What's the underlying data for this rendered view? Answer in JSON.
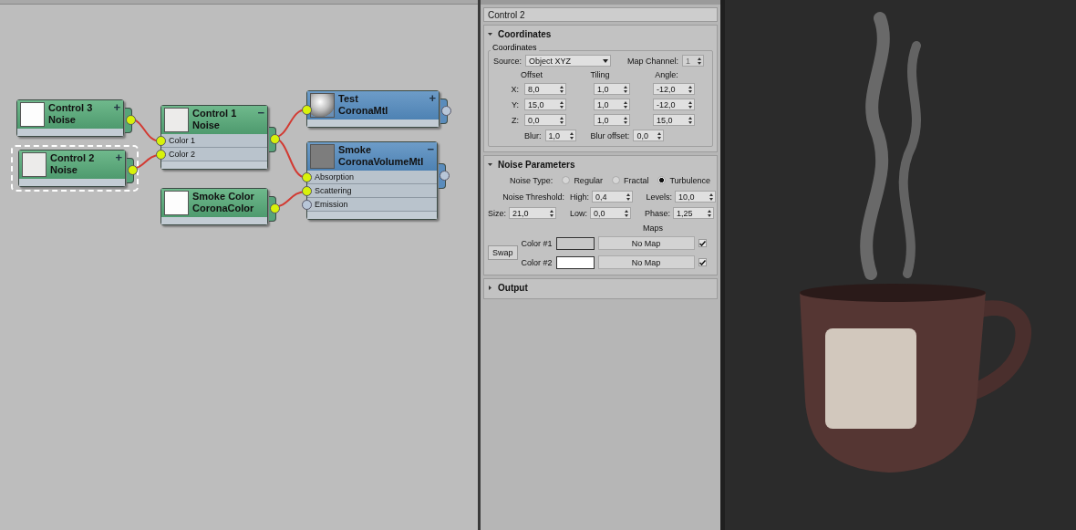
{
  "graph": {
    "nodes": [
      {
        "kind": "map",
        "title": "Control 3",
        "subtitle": "Noise",
        "toggle": "+",
        "selected": false,
        "thumbnail": {
          "kind": "white"
        }
      },
      {
        "kind": "map",
        "title": "Control 2",
        "subtitle": "Noise",
        "toggle": "+",
        "selected": true,
        "thumbnail": {
          "kind": "noise"
        }
      },
      {
        "kind": "map",
        "title": "Control 1",
        "subtitle": "Noise",
        "toggle": "−",
        "selected": false,
        "thumbnail": {
          "kind": "noise"
        },
        "slots": [
          {
            "label": "Color 1",
            "connected": true
          },
          {
            "label": "Color 2",
            "connected": true
          }
        ]
      },
      {
        "kind": "map",
        "title": "Smoke Color",
        "subtitle": "CoronaColor",
        "selected": false,
        "thumbnail": {
          "kind": "white"
        }
      },
      {
        "kind": "material",
        "title": "Test",
        "subtitle": "CoronaMtl",
        "toggle": "+",
        "selected": false,
        "thumbnail": {
          "kind": "sphere"
        }
      },
      {
        "kind": "material",
        "title": "Smoke",
        "subtitle": "CoronaVolumeMtl",
        "toggle": "−",
        "selected": false,
        "thumbnail": {
          "kind": "gray"
        },
        "slots": [
          {
            "label": "Absorption",
            "connected": true
          },
          {
            "label": "Scattering",
            "connected": true
          },
          {
            "label": "Emission",
            "connected": false
          }
        ]
      }
    ]
  },
  "name_field": {
    "value": "Control 2"
  },
  "coordinates": {
    "title": "Coordinates",
    "expanded": true,
    "group_label": "Coordinates",
    "source_label": "Source:",
    "source_value": "Object XYZ",
    "map_channel_label": "Map Channel:",
    "map_channel_value": "1",
    "map_channel_disabled": true,
    "columns": [
      "Offset",
      "Tiling",
      "Angle:"
    ],
    "rows": [
      {
        "axis": "X:",
        "values": [
          "8,0",
          "1,0",
          "-12,0"
        ]
      },
      {
        "axis": "Y:",
        "values": [
          "15,0",
          "1,0",
          "-12,0"
        ]
      },
      {
        "axis": "Z:",
        "values": [
          "0,0",
          "1,0",
          "15,0"
        ]
      }
    ],
    "blur_label": "Blur:",
    "blur_value": "1,0",
    "blur_offset_label": "Blur offset:",
    "blur_offset_value": "0,0"
  },
  "noise_parameters": {
    "title": "Noise Parameters",
    "expanded": true,
    "noise_type_label": "Noise Type:",
    "noise_types": [
      {
        "label": "Regular",
        "selected": false
      },
      {
        "label": "Fractal",
        "selected": false
      },
      {
        "label": "Turbulence",
        "selected": true
      }
    ],
    "threshold_label": "Noise Threshold:",
    "high_label": "High:",
    "high_value": "0,4",
    "levels_label": "Levels:",
    "levels_value": "10,0",
    "size_label": "Size:",
    "size_value": "21,0",
    "low_label": "Low:",
    "low_value": "0,0",
    "phase_label": "Phase:",
    "phase_value": "1,25",
    "maps_label": "Maps",
    "swap_label": "Swap",
    "colors": [
      {
        "label": "Color #1",
        "color": "#c8c8c8",
        "map": "No Map",
        "checked": true
      },
      {
        "label": "Color #2",
        "color": "#ffffff",
        "map": "No Map",
        "checked": true
      }
    ]
  },
  "output": {
    "title": "Output",
    "expanded": false
  }
}
